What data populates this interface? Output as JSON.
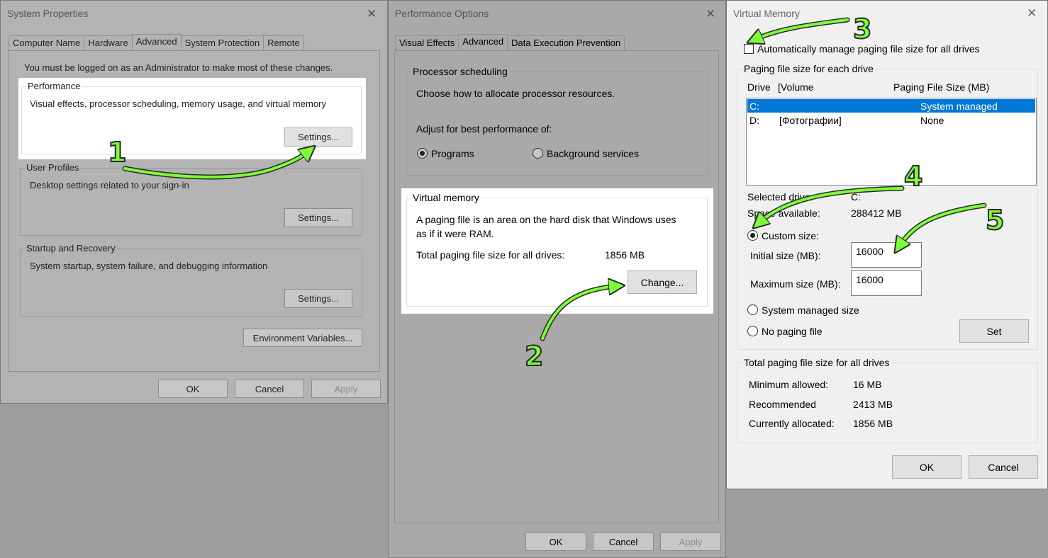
{
  "system_properties": {
    "title": "System Properties",
    "tabs": [
      "Computer Name",
      "Hardware",
      "Advanced",
      "System Protection",
      "Remote"
    ],
    "admin_notice": "You must be logged on as an Administrator to make most of these changes.",
    "performance": {
      "label": "Performance",
      "description": "Visual effects, processor scheduling, memory usage, and virtual memory",
      "button": "Settings..."
    },
    "user_profiles": {
      "label": "User Profiles",
      "description": "Desktop settings related to your sign-in",
      "button": "Settings..."
    },
    "startup_recovery": {
      "label": "Startup and Recovery",
      "description": "System startup, system failure, and debugging information",
      "button": "Settings..."
    },
    "env_button": "Environment Variables...",
    "ok": "OK",
    "cancel": "Cancel",
    "apply": "Apply"
  },
  "performance_options": {
    "title": "Performance Options",
    "tabs": [
      "Visual Effects",
      "Advanced",
      "Data Execution Prevention"
    ],
    "processor_scheduling": {
      "label": "Processor scheduling",
      "description": "Choose how to allocate processor resources.",
      "adjust_label": "Adjust for best performance of:",
      "options": [
        "Programs",
        "Background services"
      ],
      "selected": "Programs"
    },
    "virtual_memory": {
      "label": "Virtual memory",
      "description_line1": "A paging file is an area on the hard disk that Windows uses",
      "description_line2": "as if it were RAM.",
      "total_label": "Total paging file size for all drives:",
      "total_value": "1856 MB",
      "button": "Change..."
    },
    "ok": "OK",
    "cancel": "Cancel",
    "apply": "Apply"
  },
  "virtual_memory": {
    "title": "Virtual Memory",
    "auto_manage_label": "Automatically manage paging file size for all drives",
    "auto_manage_checked": false,
    "per_drive_label": "Paging file size for each drive",
    "columns": {
      "drive": "Drive",
      "volume": "[Volume",
      "size": "Paging File Size (MB)"
    },
    "drives": [
      {
        "drive": "C:",
        "volume": "",
        "size": "System managed",
        "selected": true
      },
      {
        "drive": "D:",
        "volume": "[Фотографии]",
        "size": "None",
        "selected": false
      }
    ],
    "selected_drive_label": "Selected drive:",
    "selected_drive_value": "C:",
    "space_label": "Space available:",
    "space_value": "288412 MB",
    "custom_size_label": "Custom size:",
    "initial_label": "Initial size (MB):",
    "initial_value": "16000",
    "maximum_label": "Maximum size (MB):",
    "maximum_value": "16000",
    "system_managed_label": "System managed size",
    "no_paging_label": "No paging file",
    "set_button": "Set",
    "totals": {
      "label": "Total paging file size for all drives",
      "min_label": "Minimum allowed:",
      "min_value": "16 MB",
      "rec_label": "Recommended",
      "rec_value": "2413 MB",
      "cur_label": "Currently allocated:",
      "cur_value": "1856 MB"
    },
    "ok": "OK",
    "cancel": "Cancel"
  },
  "step_markers": [
    "1",
    "2",
    "3",
    "4",
    "5"
  ],
  "annotation_color": "#7dff3c"
}
